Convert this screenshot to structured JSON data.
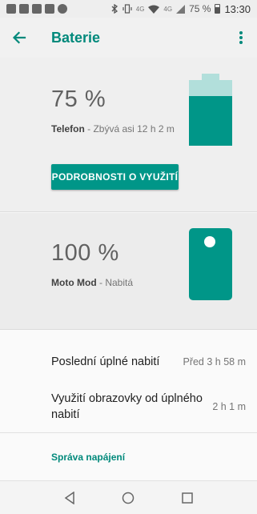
{
  "status_bar": {
    "network_label": "4G",
    "network_label_2": "4G",
    "battery_percent": "75 %",
    "time": "13:30",
    "icons": [
      "info-icon",
      "mail-icon",
      "pinwheel-icon",
      "image-icon",
      "round-icon",
      "bluetooth-icon",
      "vibrate-icon",
      "wifi-icon",
      "signal-icon",
      "battery-icon"
    ]
  },
  "toolbar": {
    "title": "Baterie",
    "back_icon": "arrow-back-icon",
    "menu_icon": "more-vert-icon"
  },
  "phone": {
    "percent": "75 %",
    "device_name": "Telefon",
    "status_text": " - Zbývá asi 12 h 2 m",
    "usage_button": "PODROBNOSTI O VYUŽITÍ",
    "battery_level": 0.75
  },
  "moto_mod": {
    "percent": "100 %",
    "device_name": "Moto Mod",
    "status_text": " - Nabitá"
  },
  "stats": [
    {
      "label": "Poslední úplné nabití",
      "value": "Před 3 h 58 m"
    },
    {
      "label": "Využití obrazovky od úplného nabití",
      "value": "2 h 1 m"
    }
  ],
  "power_management_link": "Správa napájení",
  "nav": [
    "back-icon",
    "home-icon",
    "recents-icon"
  ],
  "colors": {
    "accent": "#009688",
    "accent_light": "#b2dfdb",
    "title": "#00897b"
  }
}
